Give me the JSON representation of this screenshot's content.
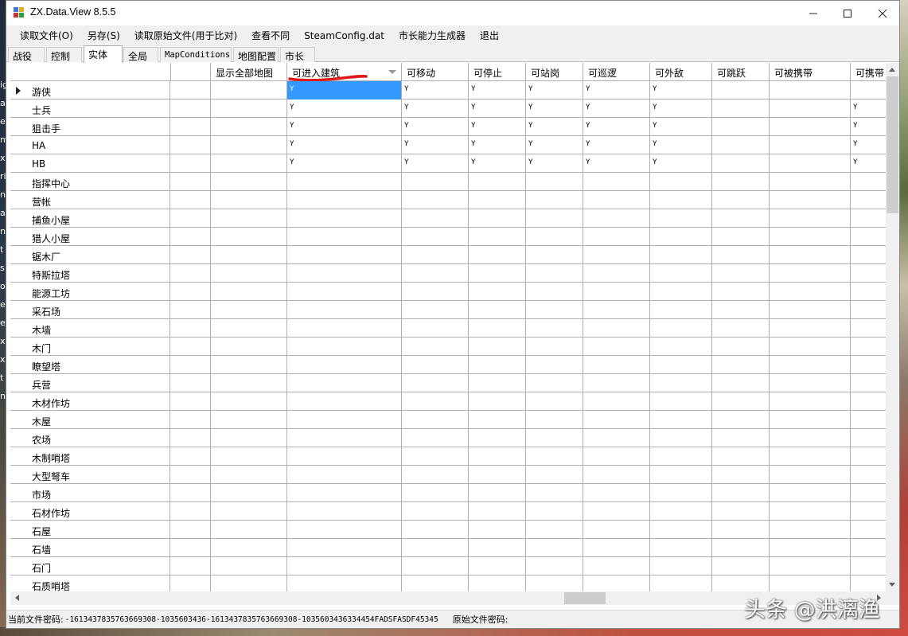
{
  "window": {
    "title": "ZX.Data.View 8.5.5"
  },
  "desktop_left_glyphs": [
    "ig",
    "ar",
    "e",
    "m",
    "x",
    "ri",
    "nt",
    "at",
    "ne",
    "t",
    "s",
    "ol",
    "ex",
    "ex",
    "x",
    "x",
    "t",
    "n"
  ],
  "menu": [
    "读取文件(O)",
    "另存(S)",
    "读取原始文件(用于比对)",
    "查看不同",
    "SteamConfig.dat",
    "市长能力生成器",
    "退出"
  ],
  "tabs": [
    {
      "label": "战役",
      "active": false
    },
    {
      "label": "控制",
      "active": false
    },
    {
      "label": "实体",
      "active": true
    },
    {
      "label": "全局",
      "active": false
    },
    {
      "label": "MapConditions",
      "active": false
    },
    {
      "label": "地图配置",
      "active": false
    },
    {
      "label": "市长",
      "active": false
    }
  ],
  "grid": {
    "columns": [
      "",
      "显示全部地图",
      "可进入建筑",
      "可移动",
      "可停止",
      "可站岗",
      "可巡逻",
      "可外敌",
      "可跳跃",
      "可被携带",
      "可携带"
    ],
    "sorted_column": "可进入建筑",
    "rows": [
      {
        "name": "游侠",
        "values": [
          "",
          "",
          "Y",
          "Y",
          "Y",
          "Y",
          "Y",
          "Y",
          "",
          "",
          ""
        ],
        "current": true
      },
      {
        "name": "士兵",
        "values": [
          "",
          "",
          "Y",
          "Y",
          "Y",
          "Y",
          "Y",
          "Y",
          "",
          "",
          "Y"
        ]
      },
      {
        "name": "狙击手",
        "values": [
          "",
          "",
          "Y",
          "Y",
          "Y",
          "Y",
          "Y",
          "Y",
          "",
          "",
          "Y"
        ]
      },
      {
        "name": "HA",
        "values": [
          "",
          "",
          "Y",
          "Y",
          "Y",
          "Y",
          "Y",
          "Y",
          "",
          "",
          "Y"
        ]
      },
      {
        "name": "HB",
        "values": [
          "",
          "",
          "Y",
          "Y",
          "Y",
          "Y",
          "Y",
          "Y",
          "",
          "",
          "Y"
        ]
      },
      {
        "name": "指挥中心",
        "values": []
      },
      {
        "name": "营帐",
        "values": []
      },
      {
        "name": "捕鱼小屋",
        "values": []
      },
      {
        "name": "猎人小屋",
        "values": []
      },
      {
        "name": "锯木厂",
        "values": []
      },
      {
        "name": "特斯拉塔",
        "values": []
      },
      {
        "name": "能源工坊",
        "values": []
      },
      {
        "name": "采石场",
        "values": []
      },
      {
        "name": "木墙",
        "values": []
      },
      {
        "name": "木门",
        "values": []
      },
      {
        "name": "瞭望塔",
        "values": []
      },
      {
        "name": "兵营",
        "values": []
      },
      {
        "name": "木材作坊",
        "values": []
      },
      {
        "name": "木屋",
        "values": []
      },
      {
        "name": "农场",
        "values": []
      },
      {
        "name": "木制哨塔",
        "values": []
      },
      {
        "name": "大型弩车",
        "values": []
      },
      {
        "name": "市场",
        "values": []
      },
      {
        "name": "石材作坊",
        "values": []
      },
      {
        "name": "石屋",
        "values": []
      },
      {
        "name": "石墙",
        "values": []
      },
      {
        "name": "石门",
        "values": []
      },
      {
        "name": "石质哨塔",
        "values": []
      }
    ],
    "selected_cell": {
      "row": 0,
      "column": "可进入建筑"
    }
  },
  "status": {
    "current_password_label": "当前文件密码:",
    "current_password_value": "-1613437835763669308-1035603436-1613437835763669308-1035603436334454FADSFASDF45345",
    "original_password_label": "原始文件密码:",
    "original_password_value": ""
  },
  "watermark": "头条 @洪漓渔",
  "colors": {
    "selection": "#3399ff",
    "annotation_mark": "#e01818"
  }
}
